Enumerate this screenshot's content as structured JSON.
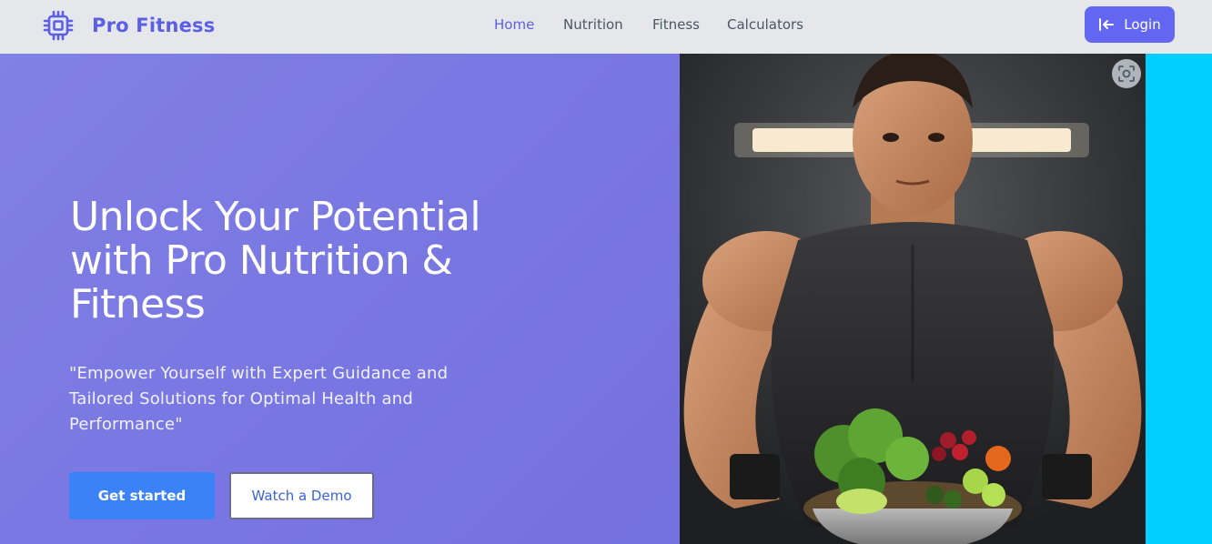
{
  "brand": {
    "name": "Pro Fitness",
    "logo_icon": "cpu-chip-icon",
    "color": "#5b5fe3"
  },
  "nav": {
    "items": [
      {
        "label": "Home",
        "active": true
      },
      {
        "label": "Nutrition",
        "active": false
      },
      {
        "label": "Fitness",
        "active": false
      },
      {
        "label": "Calculators",
        "active": false
      }
    ],
    "login": {
      "label": "Login",
      "icon": "login-arrow-icon",
      "color": "#6366f1"
    }
  },
  "hero": {
    "title": "Unlock Your Potential with Pro Nutrition & Fitness",
    "subtitle": "\"Empower Yourself with Expert Guidance and Tailored Solutions for Optimal Health and Performance\"",
    "primary_button": "Get started",
    "secondary_button": "Watch a Demo",
    "background_color": "#7a78e2",
    "image_subject": "muscular man holding a bowl of vegetables",
    "lens_icon": "visual-search-icon"
  },
  "colors": {
    "primary_button": "#3b82f6",
    "side_strip": "#00cfff",
    "navbar": "#e5e7eb"
  }
}
